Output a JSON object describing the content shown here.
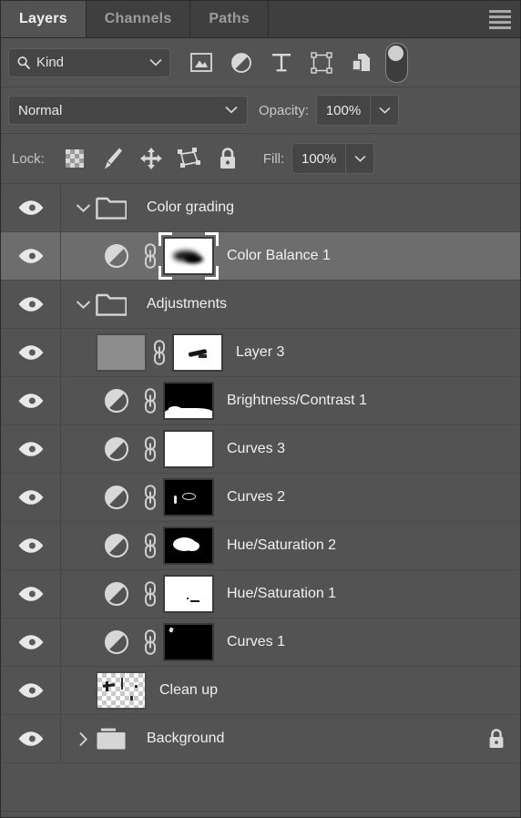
{
  "panel": {
    "tabs": [
      {
        "label": "Layers",
        "active": true
      },
      {
        "label": "Channels",
        "active": false
      },
      {
        "label": "Paths",
        "active": false
      }
    ],
    "menu_icon": "hamburger-menu-icon"
  },
  "filter": {
    "kind_label": "Kind",
    "search_icon": "magnifier-icon",
    "dropdown_icon": "chevron-down-icon",
    "icons": [
      {
        "name": "filter-pixel-layers-icon",
        "title": "Pixel layers"
      },
      {
        "name": "filter-adjustment-layers-icon",
        "title": "Adjustment layers"
      },
      {
        "name": "filter-type-layers-icon",
        "title": "Type layers"
      },
      {
        "name": "filter-shape-layers-icon",
        "title": "Shape layers"
      },
      {
        "name": "filter-smart-object-icon",
        "title": "Smart objects"
      }
    ],
    "toggle_name": "filter-enable-toggle"
  },
  "blend": {
    "mode": "Normal",
    "opacity_label": "Opacity:",
    "opacity_value": "100%",
    "dropdown_icon": "chevron-down-icon"
  },
  "lock": {
    "label": "Lock:",
    "icons": [
      {
        "name": "lock-transparent-pixels-icon"
      },
      {
        "name": "lock-image-pixels-icon"
      },
      {
        "name": "lock-position-icon"
      },
      {
        "name": "lock-artboard-nesting-icon"
      },
      {
        "name": "lock-all-icon"
      }
    ],
    "fill_label": "Fill:",
    "fill_value": "100%"
  },
  "layers": [
    {
      "name": "Color grading",
      "type": "group",
      "expanded": true,
      "selected": false,
      "visible": true,
      "indent": 0,
      "locked": false
    },
    {
      "name": "Color Balance 1",
      "type": "adjustment",
      "selected": true,
      "visible": true,
      "indent": 1,
      "mask": "blurred-dark-shape-on-white",
      "mask_selected": true,
      "linked": true,
      "locked": false
    },
    {
      "name": "Adjustments",
      "type": "group",
      "expanded": true,
      "selected": false,
      "visible": true,
      "indent": 0,
      "locked": false
    },
    {
      "name": "Layer 3",
      "type": "pixel",
      "selected": false,
      "visible": true,
      "indent": 1,
      "thumb": "flat-gray",
      "mask": "white-with-small-dark-streak",
      "linked": true,
      "locked": false
    },
    {
      "name": "Brightness/Contrast 1",
      "type": "adjustment",
      "selected": false,
      "visible": true,
      "indent": 1,
      "mask": "black-with-white-bottom-band",
      "linked": true,
      "locked": false
    },
    {
      "name": "Curves 3",
      "type": "adjustment",
      "selected": false,
      "visible": true,
      "indent": 1,
      "mask": "all-white",
      "linked": true,
      "locked": false
    },
    {
      "name": "Curves 2",
      "type": "adjustment",
      "selected": false,
      "visible": true,
      "indent": 1,
      "mask": "black-with-small-white-marks",
      "linked": true,
      "locked": false
    },
    {
      "name": "Hue/Saturation 2",
      "type": "adjustment",
      "selected": false,
      "visible": true,
      "indent": 1,
      "mask": "black-with-white-blob",
      "linked": true,
      "locked": false
    },
    {
      "name": "Hue/Saturation 1",
      "type": "adjustment",
      "selected": false,
      "visible": true,
      "indent": 1,
      "mask": "white-with-tiny-dark-marks",
      "linked": true,
      "locked": false
    },
    {
      "name": "Curves 1",
      "type": "adjustment",
      "selected": false,
      "visible": true,
      "indent": 1,
      "mask": "black-with-tiny-white-mark-top-left",
      "linked": true,
      "locked": false
    },
    {
      "name": "Clean up",
      "type": "pixel",
      "selected": false,
      "visible": true,
      "indent": 1,
      "thumb": "transparent-checkerboard",
      "linked": false,
      "locked": false
    },
    {
      "name": "Background",
      "type": "group",
      "expanded": false,
      "selected": false,
      "visible": true,
      "indent": 0,
      "locked": true
    }
  ],
  "colors": {
    "panel_bg": "#535353",
    "tab_inactive_bg": "#3f3f3f",
    "row_selected_bg": "#6d6d6d",
    "text": "#f0f0f0",
    "text_dim": "#9c9c9c",
    "field_bg": "#454545"
  },
  "icon_names": {
    "eye": "eye-visibility-icon",
    "chevron_down": "chevron-down-icon",
    "chevron_right": "chevron-right-icon",
    "folder_open": "folder-open-icon",
    "folder_closed": "folder-closed-icon",
    "adjustment": "adjustment-halfcircle-icon",
    "link": "link-chain-icon",
    "row_lock": "lock-icon"
  }
}
